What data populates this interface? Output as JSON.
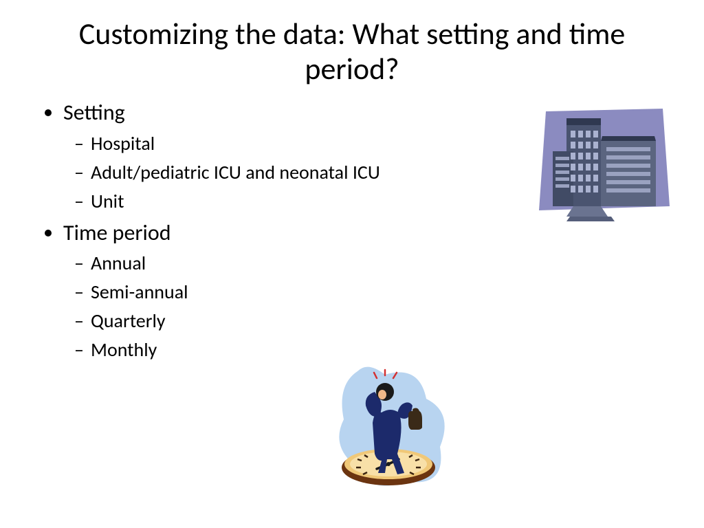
{
  "title": "Customizing the data: What setting and time period?",
  "bullets": [
    {
      "label": "Setting",
      "children": [
        "Hospital",
        "Adult/pediatric ICU and neonatal ICU",
        "Unit"
      ]
    },
    {
      "label": "Time period",
      "children": [
        "Annual",
        "Semi-annual",
        "Quarterly",
        "Monthly"
      ]
    }
  ],
  "images": {
    "hospital_alt": "hospital-building-clipart",
    "clock_alt": "stressed-businessman-on-clock-clipart"
  }
}
